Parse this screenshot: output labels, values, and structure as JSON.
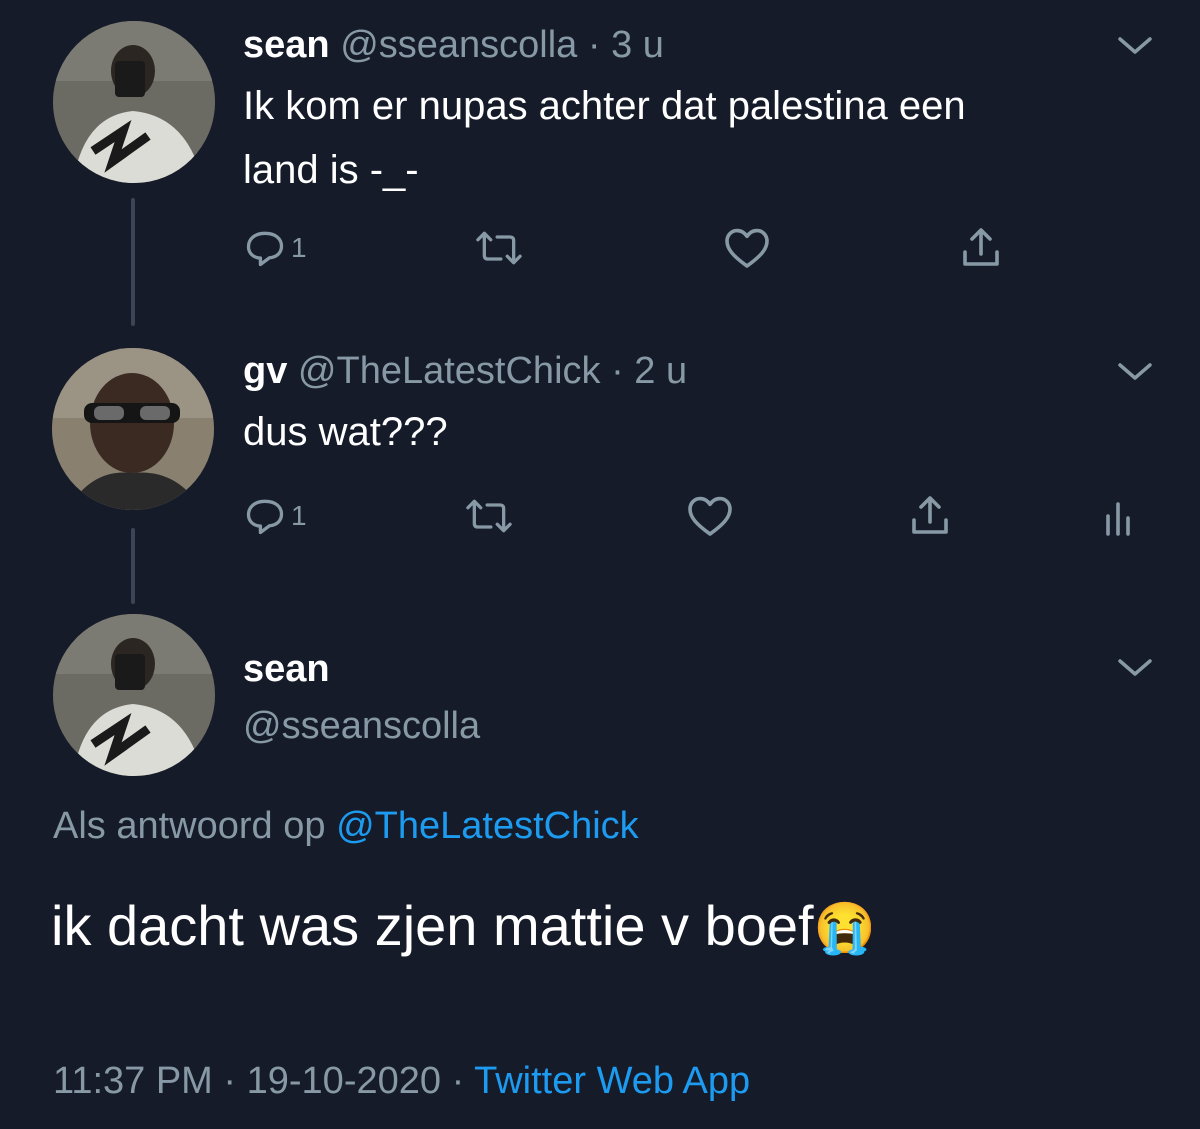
{
  "tweets": [
    {
      "name": "sean",
      "handle": "@sseanscolla",
      "time": "3 u",
      "text_line1": "Ik kom er nupas achter dat palestina een",
      "text_line2": "land is -_-",
      "reply_count": "1"
    },
    {
      "name": "gv",
      "handle": "@TheLatestChick",
      "time": "2 u",
      "text": "dus wat???",
      "reply_count": "1"
    }
  ],
  "main_tweet": {
    "name": "sean",
    "handle": "@sseanscolla",
    "reply_prefix": "Als antwoord op",
    "reply_to": "@TheLatestChick",
    "text": "ik dacht was zjen mattie v boef",
    "emoji": "😭",
    "time": "11:37 PM",
    "date": "19-10-2020",
    "source": "Twitter Web App"
  },
  "separator": "·",
  "icons": [
    "reply-icon",
    "retweet-icon",
    "like-icon",
    "share-icon",
    "analytics-icon",
    "chevron-down-icon"
  ],
  "colors": {
    "background": "#151b29",
    "muted": "#8899a6",
    "link": "#1d9bf0"
  }
}
